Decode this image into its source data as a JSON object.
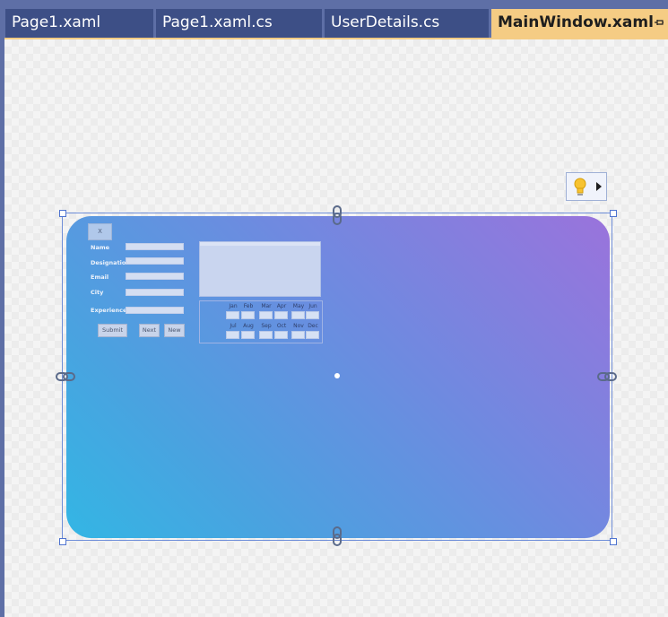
{
  "tabs": [
    {
      "label": "Page1.xaml",
      "active": false
    },
    {
      "label": "Page1.xaml.cs",
      "active": false
    },
    {
      "label": "UserDetails.cs",
      "active": false
    },
    {
      "label": "MainWindow.xaml",
      "active": true
    }
  ],
  "colors": {
    "tab_active": "#f5cc84",
    "tab_inactive": "#3d4f86",
    "frame": "#5e6fa6",
    "gradient_start": "#33b6e4",
    "gradient_end": "#9a73dc"
  },
  "form": {
    "close_label": "X",
    "fields": [
      {
        "label": "Name"
      },
      {
        "label": "Designation"
      },
      {
        "label": "Email"
      },
      {
        "label": "City"
      },
      {
        "label": "Experience"
      }
    ],
    "buttons": {
      "submit": "Submit",
      "next": "Next",
      "new": "New"
    },
    "months": [
      "Jan",
      "Feb",
      "Mar",
      "Apr",
      "May",
      "Jun",
      "Jul",
      "Aug",
      "Sep",
      "Oct",
      "Nov",
      "Dec"
    ]
  },
  "icons": {
    "pin": "pin-icon",
    "quick_actions": "lightbulb-icon",
    "expand": "triangle-right-icon",
    "anchor": "link-icon"
  }
}
